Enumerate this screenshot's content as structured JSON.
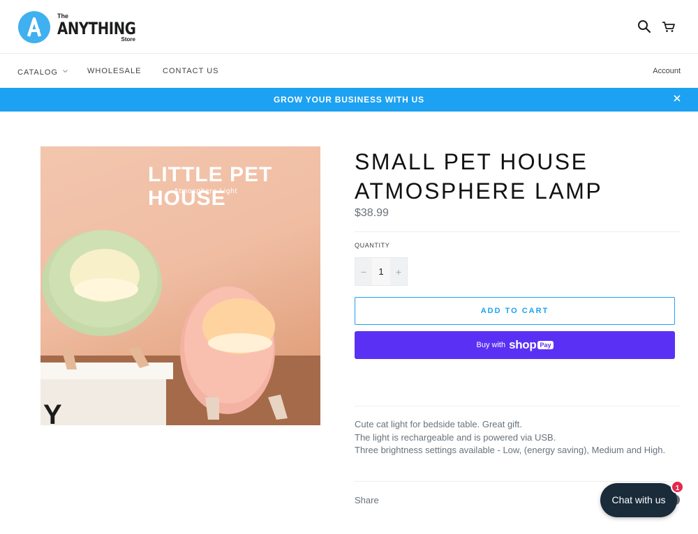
{
  "brand": {
    "logo_letter": "A",
    "logo_the": "The",
    "logo_main": "ANYTHING",
    "logo_store": "Store",
    "accent_color": "#3fb0f0"
  },
  "header_icons": [
    "search-icon",
    "cart-icon"
  ],
  "nav": {
    "items": [
      {
        "label": "CATALOG",
        "has_dropdown": true
      },
      {
        "label": "WHOLESALE"
      },
      {
        "label": "CONTACT US"
      }
    ],
    "account_label": "Account"
  },
  "banner": {
    "text": "GROW YOUR BUSINESS WITH US",
    "close_icon": "close-icon",
    "color": "#1da1f2"
  },
  "product": {
    "image": {
      "title": "LITTLE PET HOUSE",
      "subtitle": "Atmosphere Light"
    },
    "title": "SMALL PET HOUSE ATMOSPHERE LAMP",
    "price": "$38.99",
    "quantity_label": "QUANTITY",
    "quantity_minus": "−",
    "quantity_value": "1",
    "quantity_plus": "+",
    "add_to_cart_label": "ADD TO CART",
    "shop_pay": {
      "buy_with": "Buy with",
      "logo": "shop",
      "pay": "Pay",
      "color": "#5a31f4"
    },
    "description": [
      "Cute cat light for bedside table. Great gift.",
      "The light is rechargeable and is powered via USB.",
      "Three brightness settings available - Low, (energy saving), Medium and High."
    ],
    "share_label": "Share"
  },
  "chat": {
    "label": "Chat with us",
    "badge_count": "1"
  }
}
